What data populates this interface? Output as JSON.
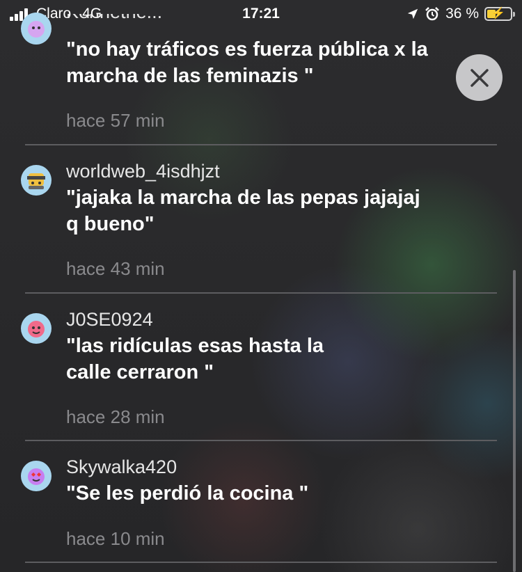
{
  "status_bar": {
    "carrier": "Claro",
    "network": "4G",
    "time": "17:21",
    "battery_percent": "36 %",
    "battery_level": 0.36
  },
  "close_label": "✕",
  "comments": [
    {
      "username": "Kennethe...",
      "message_line1": "\"no hay tráficos es fuerza pública x la",
      "message_line2": "marcha de las feminazis \"",
      "time": "hace 57 min"
    },
    {
      "username": "worldweb_4isdhjzt",
      "message_line1": "\"jajaka la marcha de las pepas jajajaj",
      "message_line2": "q bueno\"",
      "time": "hace 43 min"
    },
    {
      "username": "J0SE0924",
      "message_line1": "\"las ridículas esas hasta la",
      "message_line2": "calle cerraron \"",
      "time": "hace 28 min"
    },
    {
      "username": "Skywalka420",
      "message_line1": "\"Se les perdió la cocina \"",
      "message_line2": "",
      "time": "hace 10 min"
    }
  ]
}
